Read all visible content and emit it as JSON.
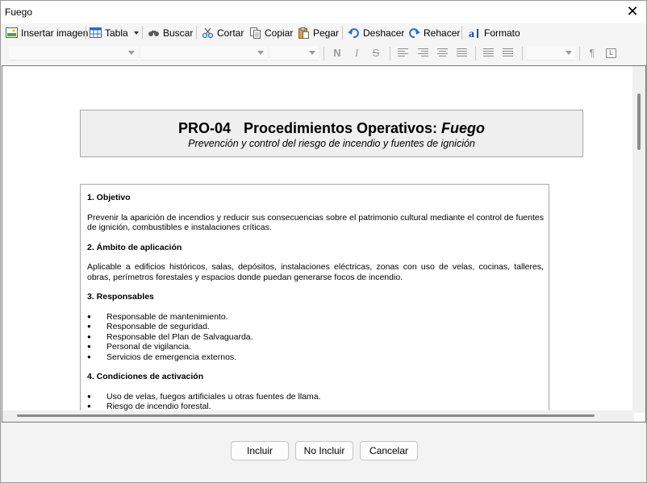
{
  "window": {
    "title": "Fuego",
    "close_glyph": "✕"
  },
  "toolbar": {
    "insert_image": "Insertar imagen",
    "table": "Tabla",
    "find": "Buscar",
    "cut": "Cortar",
    "copy": "Copiar",
    "paste": "Pegar",
    "undo": "Deshacer",
    "redo": "Rehacer",
    "format": "Formato"
  },
  "format_bar": {
    "bold": "N",
    "italic": "I",
    "strike": "S",
    "pilcrow": "¶"
  },
  "document": {
    "header": {
      "code": "PRO-04",
      "title_plain": "Procedimientos Operativos: ",
      "title_italic": "Fuego",
      "subtitle": "Prevención y control del riesgo de incendio y fuentes de ignición"
    },
    "sections": [
      {
        "heading": "1. Objetivo",
        "text": "Prevenir la aparición de incendios y reducir sus consecuencias sobre el patrimonio cultural mediante el control de fuentes de ignición, combustibles e instalaciones críticas."
      },
      {
        "heading": "2. Ámbito de aplicación",
        "text": "Aplicable a edificios históricos, salas, depósitos, instalaciones eléctricas, zonas con uso de velas, cocinas, talleres, obras, perímetros forestales y espacios donde puedan generarse focos de incendio."
      },
      {
        "heading": "3. Responsables",
        "items": [
          "Responsable de mantenimiento.",
          "Responsable de seguridad.",
          "Responsable del Plan de Salvaguarda.",
          "Personal de vigilancia.",
          "Servicios de emergencia externos."
        ]
      },
      {
        "heading": "4. Condiciones de activación",
        "items": [
          "Uso de velas, fuegos artificiales u otras fuentes de llama.",
          "Riesgo de incendio forestal."
        ]
      }
    ]
  },
  "buttons": {
    "include": "Incluir",
    "not_include": "No Incluir",
    "cancel": "Cancelar"
  }
}
